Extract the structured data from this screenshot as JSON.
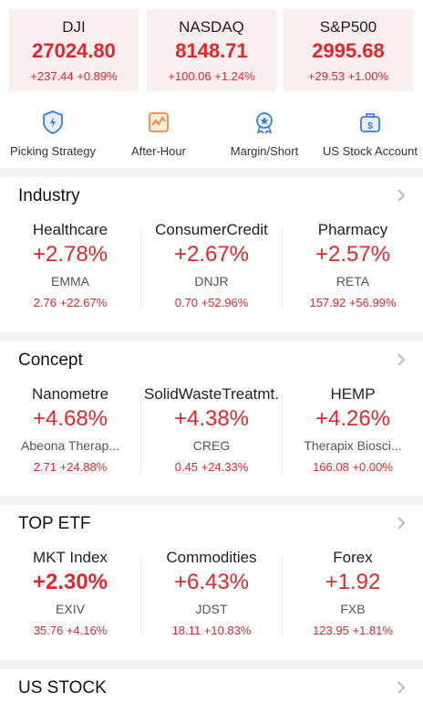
{
  "indices": [
    {
      "name": "DJI",
      "value": "27024.80",
      "change": "+237.44 +0.89%"
    },
    {
      "name": "NASDAQ",
      "value": "8148.71",
      "change": "+100.06 +1.24%"
    },
    {
      "name": "S&P500",
      "value": "2995.68",
      "change": "+29.53 +1.00%"
    }
  ],
  "shortcuts": [
    {
      "label": "Picking Strategy",
      "icon": "lightbulb-shield-icon"
    },
    {
      "label": "After-Hour",
      "icon": "moon-chart-icon"
    },
    {
      "label": "Margin/Short",
      "icon": "medal-icon"
    },
    {
      "label": "US Stock Account",
      "icon": "briefcase-dollar-icon"
    }
  ],
  "sections": {
    "industry": {
      "title": "Industry",
      "items": [
        {
          "name": "Healthcare",
          "pct": "+2.78%",
          "stock": "EMMA",
          "stock_change": "2.76 +22.67%"
        },
        {
          "name": "ConsumerCredit",
          "pct": "+2.67%",
          "stock": "DNJR",
          "stock_change": "0.70 +52.96%"
        },
        {
          "name": "Pharmacy",
          "pct": "+2.57%",
          "stock": "RETA",
          "stock_change": "157.92 +56.99%"
        }
      ]
    },
    "concept": {
      "title": "Concept",
      "items": [
        {
          "name": "Nanometre",
          "pct": "+4.68%",
          "stock": "Abeona Therap...",
          "stock_change": "2.71 +24.88%"
        },
        {
          "name": "SolidWasteTreatmt.",
          "pct": "+4.38%",
          "stock": "CREG",
          "stock_change": "0.45 +24.33%"
        },
        {
          "name": "HEMP",
          "pct": "+4.26%",
          "stock": "Therapix Biosci...",
          "stock_change": "166.08 +0.00%"
        }
      ]
    },
    "top_etf": {
      "title": "TOP ETF",
      "items": [
        {
          "name": "MKT Index",
          "pct": "+2.30%",
          "stock": "EXIV",
          "stock_change": "35.76 +4.16%"
        },
        {
          "name": "Commodities",
          "pct": "+6.43%",
          "stock": "JDST",
          "stock_change": "18.11 +10.83%"
        },
        {
          "name": "Forex",
          "pct": "+1.92",
          "stock": "FXB",
          "stock_change": "123.95 +1.81%"
        }
      ]
    },
    "us_stock": {
      "title": "US STOCK"
    }
  },
  "colors": {
    "up": "#e0272c",
    "card_bg": "#fbeeee",
    "icon_blue": "#3b7de0",
    "icon_orange": "#f08a3c"
  }
}
